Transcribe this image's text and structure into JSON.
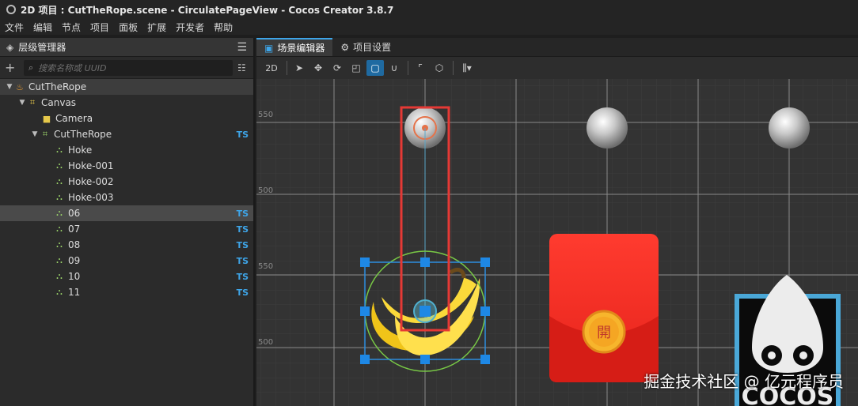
{
  "window": {
    "title": "2D 项目 : CutTheRope.scene - CirculatePageView - Cocos Creator 3.8.7"
  },
  "menu": [
    "文件",
    "编辑",
    "节点",
    "项目",
    "面板",
    "扩展",
    "开发者",
    "帮助"
  ],
  "hierarchy": {
    "tab_label": "层级管理器",
    "search_placeholder": "搜索名称或 UUID",
    "nodes": [
      {
        "label": "CutTheRope",
        "icon": "scene-icon",
        "ts": ""
      },
      {
        "label": "Canvas",
        "icon": "canvas-icon",
        "ts": ""
      },
      {
        "label": "Camera",
        "icon": "camera-icon",
        "ts": ""
      },
      {
        "label": "CutTheRope",
        "icon": "node-icon",
        "ts": "TS"
      },
      {
        "label": "Hoke",
        "icon": "node-icon",
        "ts": ""
      },
      {
        "label": "Hoke-001",
        "icon": "node-icon",
        "ts": ""
      },
      {
        "label": "Hoke-002",
        "icon": "node-icon",
        "ts": ""
      },
      {
        "label": "Hoke-003",
        "icon": "node-icon",
        "ts": ""
      },
      {
        "label": "06",
        "icon": "node-icon",
        "ts": "TS"
      },
      {
        "label": "07",
        "icon": "node-icon",
        "ts": "TS"
      },
      {
        "label": "08",
        "icon": "node-icon",
        "ts": "TS"
      },
      {
        "label": "09",
        "icon": "node-icon",
        "ts": "TS"
      },
      {
        "label": "10",
        "icon": "node-icon",
        "ts": "TS"
      },
      {
        "label": "11",
        "icon": "node-icon",
        "ts": "TS"
      }
    ]
  },
  "scene": {
    "tabs": [
      {
        "label": "场景编辑器",
        "icon": "scene-editor-icon"
      },
      {
        "label": "项目设置",
        "icon": "gear-icon"
      }
    ],
    "mode_label": "2D",
    "y_labels": [
      "550",
      "500",
      "550",
      "500"
    ],
    "envelope_char": "開",
    "logo_text": "COCOS"
  },
  "watermark": "掘金技术社区 @ 亿元程序员",
  "colors": {
    "accent": "#3ea5e8",
    "selection": "#e53935",
    "gizmo": "#1e88e5"
  }
}
